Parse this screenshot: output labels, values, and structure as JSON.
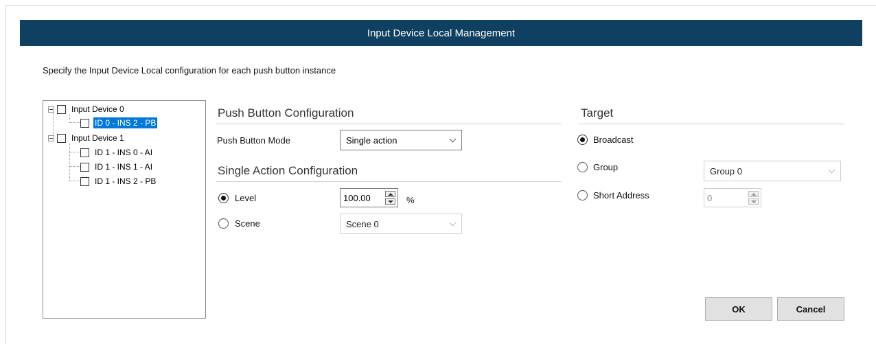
{
  "window": {
    "title": "Input Device Local Management"
  },
  "instructions": "Specify the Input Device Local configuration for each push button instance",
  "tree": {
    "nodes": [
      {
        "label": "Input Device 0",
        "level": 0,
        "expanded": true,
        "checked": false,
        "selected": false
      },
      {
        "label": "ID 0 - INS 2 - PB",
        "level": 1,
        "checked": false,
        "selected": true
      },
      {
        "label": "Input Device 1",
        "level": 0,
        "expanded": true,
        "checked": false,
        "selected": false
      },
      {
        "label": "ID 1 - INS 0 - AI",
        "level": 1,
        "checked": false,
        "selected": false
      },
      {
        "label": "ID 1 - INS 1 - AI",
        "level": 1,
        "checked": false,
        "selected": false
      },
      {
        "label": "ID 1 - INS 2 - PB",
        "level": 1,
        "checked": false,
        "selected": false
      }
    ]
  },
  "push_button_config": {
    "title": "Push Button Configuration",
    "mode_label": "Push Button Mode",
    "mode_value": "Single action"
  },
  "single_action_config": {
    "title": "Single Action Configuration",
    "level_label": "Level",
    "level_selected": true,
    "level_value": "100.00",
    "level_unit": "%",
    "scene_label": "Scene",
    "scene_selected": false,
    "scene_value": "Scene 0"
  },
  "target": {
    "title": "Target",
    "broadcast_label": "Broadcast",
    "broadcast_selected": true,
    "group_label": "Group",
    "group_selected": false,
    "group_value": "Group 0",
    "short_address_label": "Short Address",
    "short_address_selected": false,
    "short_address_value": "0"
  },
  "buttons": {
    "ok": "OK",
    "cancel": "Cancel"
  },
  "colors": {
    "titlebar": "#0f4062",
    "selection": "#0078d7"
  }
}
